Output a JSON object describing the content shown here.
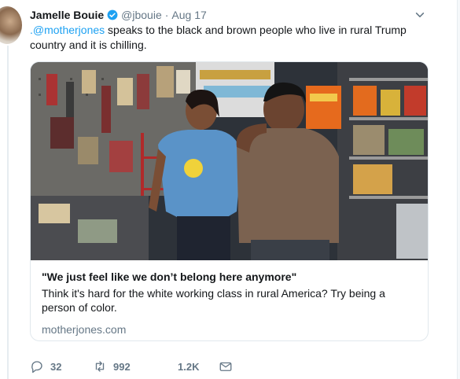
{
  "tweet": {
    "author_name": "Jamelle Bouie",
    "handle": "@jbouie",
    "separator": "·",
    "date": "Aug 17",
    "mention": ".@motherjones",
    "text": " speaks to the black and brown people who live in rural Trump country and it is chilling."
  },
  "card": {
    "image_alt": "Two people standing in a small convenience store",
    "title": "\"We just feel like we don’t belong here anymore\"",
    "description": "Think it's hard for the white working class in rural America? Try being a person of color.",
    "domain": "motherjones.com"
  },
  "actions": {
    "reply_count": "32",
    "retweet_count": "992",
    "like_count": "1.2K"
  },
  "colors": {
    "accent": "#1da1f2",
    "secondary_text": "#657786",
    "border": "#e1e8ed"
  },
  "icons": [
    "verified-icon",
    "caret-down-icon",
    "reply-icon",
    "retweet-icon",
    "like-icon",
    "direct-message-icon"
  ]
}
